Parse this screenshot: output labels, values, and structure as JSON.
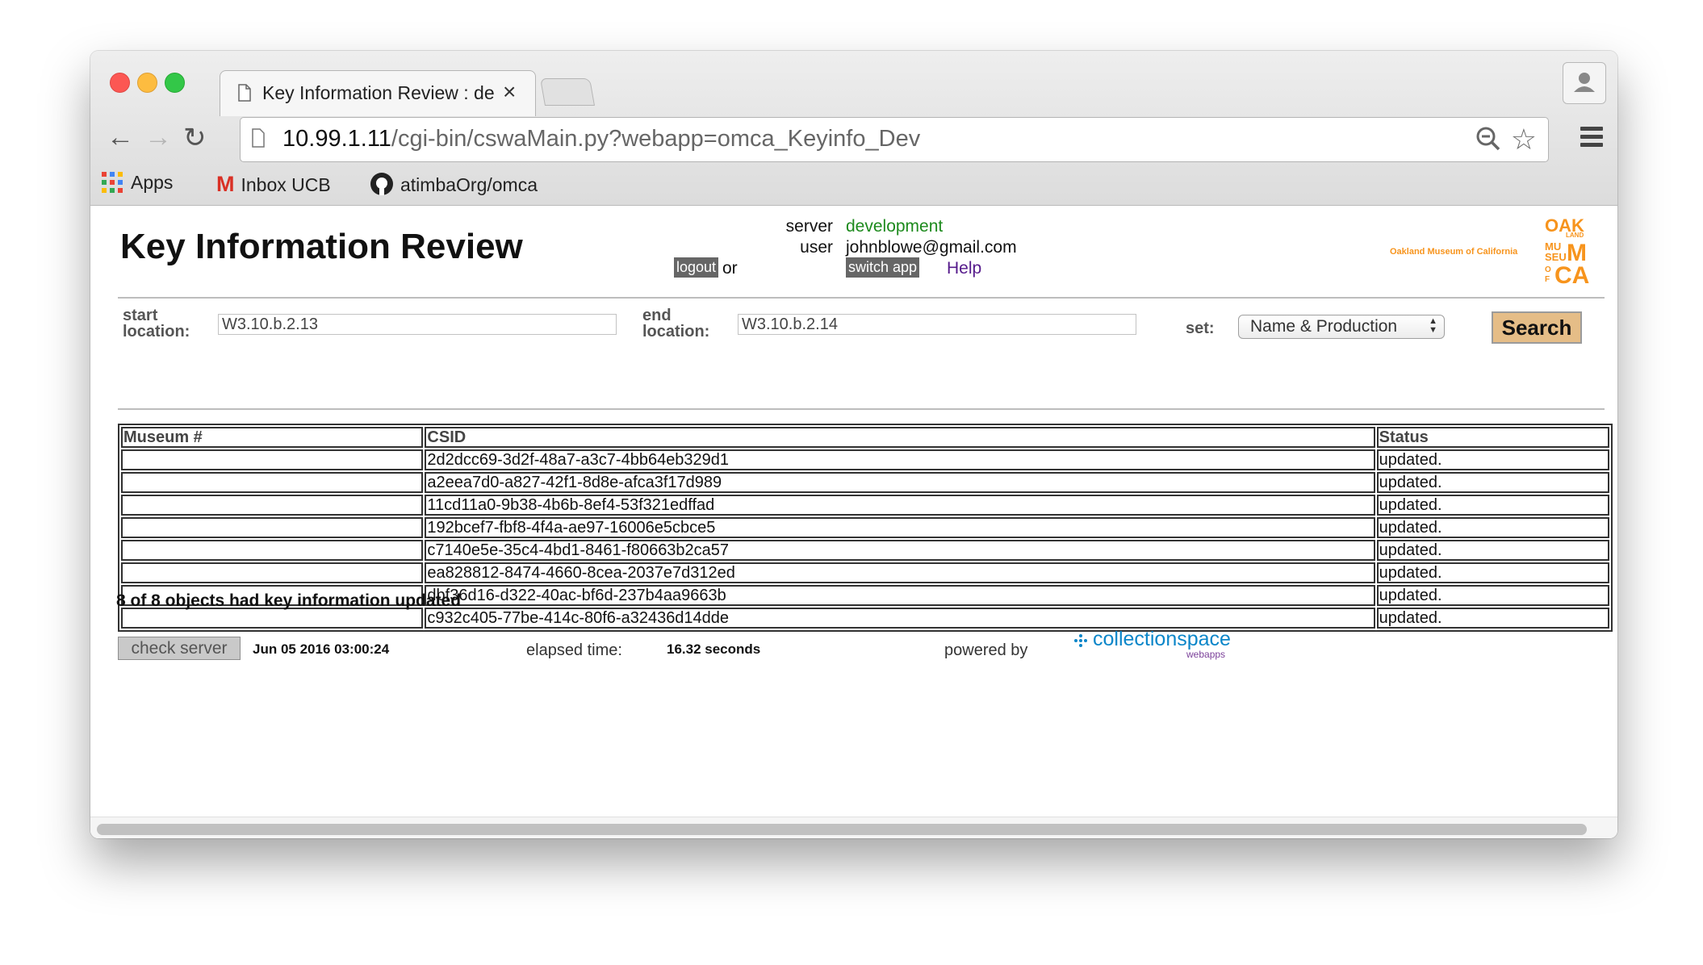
{
  "browser": {
    "tab_title": "Key Information Review : de",
    "tab_close": "×",
    "url_host": "10.99.1.11",
    "url_path": "/cgi-bin/cswaMain.py?webapp=omca_Keyinfo_Dev",
    "bookmarks": [
      {
        "label": "Apps",
        "icon": "apps-grid-icon"
      },
      {
        "label": "Inbox UCB",
        "icon": "gmail-icon"
      },
      {
        "label": "atimbaOrg/omca",
        "icon": "github-icon"
      }
    ]
  },
  "header": {
    "title": "Key Information Review",
    "server_label": "server",
    "server_value": "development",
    "user_label": "user",
    "user_value": "johnblowe@gmail.com",
    "logout_label": "logout",
    "or_text": "or",
    "switch_app_label": "switch app",
    "help_label": "Help",
    "museum_name": "Oakland Museum of California",
    "env_color": "#1d8a1d"
  },
  "form": {
    "start_label_1": "start",
    "start_label_2": "location:",
    "start_value": "W3.10.b.2.13",
    "end_label_1": "end",
    "end_label_2": "location:",
    "end_value": "W3.10.b.2.14",
    "set_label": "set:",
    "set_value": "Name & Production",
    "search_label": "Search",
    "search_color": "#e5bd87"
  },
  "table": {
    "headers": [
      "Museum #",
      "CSID",
      "Status"
    ],
    "rows": [
      {
        "museum": "",
        "csid": "2d2dcc69-3d2f-48a7-a3c7-4bb64eb329d1",
        "status": "updated."
      },
      {
        "museum": "",
        "csid": "a2eea7d0-a827-42f1-8d8e-afca3f17d989",
        "status": "updated."
      },
      {
        "museum": "",
        "csid": "11cd11a0-9b38-4b6b-8ef4-53f321edffad",
        "status": "updated."
      },
      {
        "museum": "",
        "csid": "192bcef7-fbf8-4f4a-ae97-16006e5cbce5",
        "status": "updated."
      },
      {
        "museum": "",
        "csid": "c7140e5e-35c4-4bd1-8461-f80663b2ca57",
        "status": "updated."
      },
      {
        "museum": "",
        "csid": "ea828812-8474-4660-8cea-2037e7d312ed",
        "status": "updated."
      },
      {
        "museum": "",
        "csid": "dbf36d16-d322-40ac-bf6d-237b4aa9663b",
        "status": "updated."
      },
      {
        "museum": "",
        "csid": "c932c405-77be-414c-80f6-a32436d14dde",
        "status": "updated."
      }
    ]
  },
  "summary": "8 of 8 objects had key information updated",
  "footer": {
    "check_server_label": "check server",
    "timestamp": "Jun 05 2016 03:00:24",
    "elapsed_label": "elapsed time:",
    "elapsed_value": "16.32 seconds",
    "powered_label": "powered by",
    "cs_name": "collectionspace",
    "cs_sub": "webapps"
  }
}
